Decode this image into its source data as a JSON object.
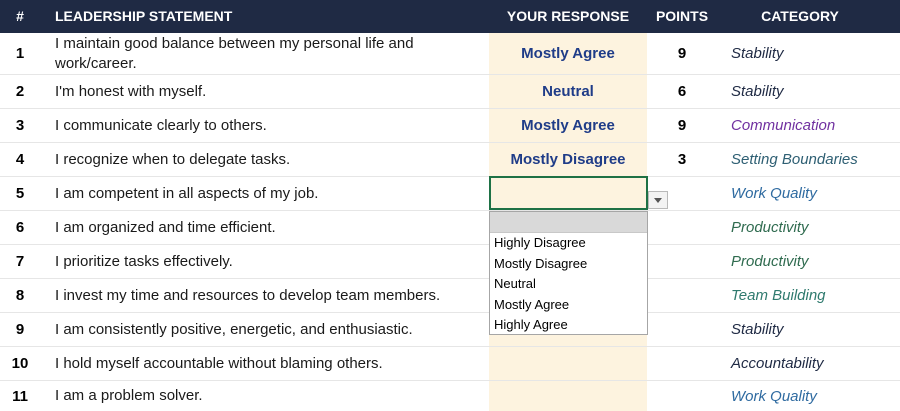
{
  "headers": {
    "num": "#",
    "statement": "LEADERSHIP STATEMENT",
    "response": "YOUR RESPONSE",
    "points": "POINTS",
    "category": "CATEGORY"
  },
  "rows": [
    {
      "num": "1",
      "statement_line1": "I maintain good balance between my personal life and",
      "statement_line2": "work/career.",
      "response": "Mostly Agree",
      "points": "9",
      "category": "Stability"
    },
    {
      "num": "2",
      "statement_line1": "I'm honest with myself.",
      "response": "Neutral",
      "points": "6",
      "category": "Stability"
    },
    {
      "num": "3",
      "statement_line1": "I communicate clearly to others.",
      "response": "Mostly Agree",
      "points": "9",
      "category": "Communication"
    },
    {
      "num": "4",
      "statement_line1": "I recognize when to delegate tasks.",
      "response": "Mostly Disagree",
      "points": "3",
      "category": "Setting Boundaries"
    },
    {
      "num": "5",
      "statement_line1": "I am competent in all aspects of my job.",
      "response": "",
      "points": "",
      "category": "Work Quality"
    },
    {
      "num": "6",
      "statement_line1": "I am organized and time efficient.",
      "response": "",
      "points": "",
      "category": "Productivity"
    },
    {
      "num": "7",
      "statement_line1": "I prioritize tasks effectively.",
      "response": "",
      "points": "",
      "category": "Productivity"
    },
    {
      "num": "8",
      "statement_line1": "I invest my time and resources to develop team members.",
      "response": "",
      "points": "",
      "category": "Team Building"
    },
    {
      "num": "9",
      "statement_line1": "I am consistently positive, energetic, and enthusiastic.",
      "response": "",
      "points": "",
      "category": "Stability"
    },
    {
      "num": "10",
      "statement_line1": "I hold myself accountable without blaming others.",
      "response": "",
      "points": "",
      "category": "Accountability"
    },
    {
      "num": "11",
      "statement_line1": "I am a problem solver.",
      "response": "",
      "points": "",
      "category": "Work Quality"
    }
  ],
  "dropdown": {
    "options": [
      "Highly Disagree",
      "Mostly Disagree",
      "Neutral",
      "Mostly Agree",
      "Highly Agree"
    ]
  },
  "colors": {
    "header_bg": "#1f2a44",
    "response_bg": "#fdf3df",
    "response_text": "#1f3c88",
    "cat_stability": "#1f2a44",
    "cat_communication": "#7030a0",
    "cat_setting_boundaries": "#2e5f73",
    "cat_work_quality": "#2e6aa0",
    "cat_productivity": "#2f6b4f",
    "cat_team_building": "#2f7a6e",
    "cat_accountability": "#1f2a44",
    "selection_border": "#1e7145"
  }
}
